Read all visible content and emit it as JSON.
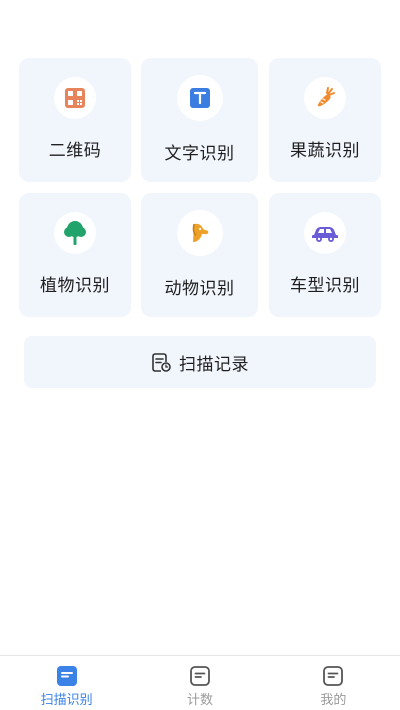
{
  "tiles": [
    {
      "label": "二维码",
      "icon": "qr-code-icon"
    },
    {
      "label": "文字识别",
      "icon": "text-icon"
    },
    {
      "label": "果蔬识别",
      "icon": "carrot-icon"
    },
    {
      "label": "植物识别",
      "icon": "tree-icon"
    },
    {
      "label": "动物识别",
      "icon": "dog-icon"
    },
    {
      "label": "车型识别",
      "icon": "car-icon"
    }
  ],
  "record_button": {
    "label": "扫描记录",
    "icon": "document-clock-icon"
  },
  "tabbar": {
    "tabs": [
      {
        "label": "扫描识别",
        "active": true,
        "icon": "list-icon"
      },
      {
        "label": "计数",
        "active": false,
        "icon": "list-icon"
      },
      {
        "label": "我的",
        "active": false,
        "icon": "list-icon"
      }
    ]
  },
  "colors": {
    "tile_bg": "#f1f5fc",
    "accent": "#3b82e6",
    "qr_orange": "#e8845c",
    "text_blue": "#3b7de0",
    "carrot_orange": "#f08a2c",
    "tree_green": "#22a36b",
    "dog_orange": "#eea128",
    "car_purple": "#6a5bd6"
  }
}
